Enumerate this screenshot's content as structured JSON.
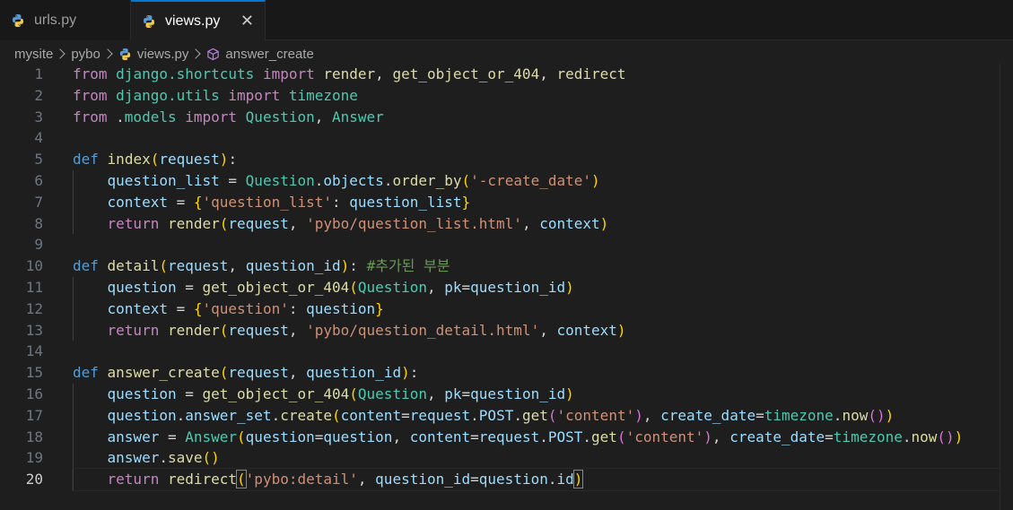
{
  "tabs": [
    {
      "label": "urls.py",
      "icon": "python-icon",
      "active": false
    },
    {
      "label": "views.py",
      "icon": "python-icon",
      "active": true
    }
  ],
  "close_glyph": "✕",
  "breadcrumb": {
    "items": [
      "mysite",
      "pybo",
      "views.py",
      "answer_create"
    ]
  },
  "colors": {
    "accent": "#0078d4",
    "background": "#1e1e1e",
    "keyword": "#c586c0",
    "def": "#569cd6",
    "function": "#dcdcaa",
    "class": "#4ec9b0",
    "variable": "#9cdcfe",
    "string": "#ce9178",
    "comment": "#6a9955"
  },
  "current_line": 20,
  "code_lines": [
    {
      "n": "1",
      "tokens": [
        [
          "kw",
          "from"
        ],
        [
          "txt",
          " "
        ],
        [
          "cls",
          "django.shortcuts"
        ],
        [
          "txt",
          " "
        ],
        [
          "kw",
          "import"
        ],
        [
          "txt",
          " "
        ],
        [
          "fn",
          "render"
        ],
        [
          "txt",
          ", "
        ],
        [
          "fn",
          "get_object_or_404"
        ],
        [
          "txt",
          ", "
        ],
        [
          "fn",
          "redirect"
        ]
      ]
    },
    {
      "n": "2",
      "tokens": [
        [
          "kw",
          "from"
        ],
        [
          "txt",
          " "
        ],
        [
          "cls",
          "django.utils"
        ],
        [
          "txt",
          " "
        ],
        [
          "kw",
          "import"
        ],
        [
          "txt",
          " "
        ],
        [
          "cls",
          "timezone"
        ]
      ]
    },
    {
      "n": "3",
      "tokens": [
        [
          "kw",
          "from"
        ],
        [
          "txt",
          " ."
        ],
        [
          "cls",
          "models"
        ],
        [
          "txt",
          " "
        ],
        [
          "kw",
          "import"
        ],
        [
          "txt",
          " "
        ],
        [
          "cls",
          "Question"
        ],
        [
          "txt",
          ", "
        ],
        [
          "cls",
          "Answer"
        ]
      ]
    },
    {
      "n": "4",
      "tokens": []
    },
    {
      "n": "5",
      "tokens": [
        [
          "def",
          "def"
        ],
        [
          "txt",
          " "
        ],
        [
          "fn",
          "index"
        ],
        [
          "b1",
          "("
        ],
        [
          "var",
          "request"
        ],
        [
          "b1",
          ")"
        ],
        [
          "txt",
          ":"
        ]
      ]
    },
    {
      "n": "6",
      "indent": true,
      "tokens": [
        [
          "txt",
          "    "
        ],
        [
          "var",
          "question_list"
        ],
        [
          "txt",
          " = "
        ],
        [
          "cls",
          "Question"
        ],
        [
          "txt",
          "."
        ],
        [
          "var",
          "objects"
        ],
        [
          "txt",
          "."
        ],
        [
          "fn",
          "order_by"
        ],
        [
          "b1",
          "("
        ],
        [
          "str",
          "'-create_date'"
        ],
        [
          "b1",
          ")"
        ]
      ]
    },
    {
      "n": "7",
      "indent": true,
      "tokens": [
        [
          "txt",
          "    "
        ],
        [
          "var",
          "context"
        ],
        [
          "txt",
          " = "
        ],
        [
          "b1",
          "{"
        ],
        [
          "str",
          "'question_list'"
        ],
        [
          "txt",
          ": "
        ],
        [
          "var",
          "question_list"
        ],
        [
          "b1",
          "}"
        ]
      ]
    },
    {
      "n": "8",
      "indent": true,
      "tokens": [
        [
          "txt",
          "    "
        ],
        [
          "kw",
          "return"
        ],
        [
          "txt",
          " "
        ],
        [
          "fn",
          "render"
        ],
        [
          "b1",
          "("
        ],
        [
          "var",
          "request"
        ],
        [
          "txt",
          ", "
        ],
        [
          "str",
          "'pybo/question_list.html'"
        ],
        [
          "txt",
          ", "
        ],
        [
          "var",
          "context"
        ],
        [
          "b1",
          ")"
        ]
      ]
    },
    {
      "n": "9",
      "tokens": []
    },
    {
      "n": "10",
      "tokens": [
        [
          "def",
          "def"
        ],
        [
          "txt",
          " "
        ],
        [
          "fn",
          "detail"
        ],
        [
          "b1",
          "("
        ],
        [
          "var",
          "request"
        ],
        [
          "txt",
          ", "
        ],
        [
          "var",
          "question_id"
        ],
        [
          "b1",
          ")"
        ],
        [
          "txt",
          ": "
        ],
        [
          "cmt",
          "#추가된 부분"
        ]
      ]
    },
    {
      "n": "11",
      "indent": true,
      "tokens": [
        [
          "txt",
          "    "
        ],
        [
          "var",
          "question"
        ],
        [
          "txt",
          " = "
        ],
        [
          "fn",
          "get_object_or_404"
        ],
        [
          "b1",
          "("
        ],
        [
          "cls",
          "Question"
        ],
        [
          "txt",
          ", "
        ],
        [
          "var",
          "pk"
        ],
        [
          "txt",
          "="
        ],
        [
          "var",
          "question_id"
        ],
        [
          "b1",
          ")"
        ]
      ]
    },
    {
      "n": "12",
      "indent": true,
      "tokens": [
        [
          "txt",
          "    "
        ],
        [
          "var",
          "context"
        ],
        [
          "txt",
          " = "
        ],
        [
          "b1",
          "{"
        ],
        [
          "str",
          "'question'"
        ],
        [
          "txt",
          ": "
        ],
        [
          "var",
          "question"
        ],
        [
          "b1",
          "}"
        ]
      ]
    },
    {
      "n": "13",
      "indent": true,
      "tokens": [
        [
          "txt",
          "    "
        ],
        [
          "kw",
          "return"
        ],
        [
          "txt",
          " "
        ],
        [
          "fn",
          "render"
        ],
        [
          "b1",
          "("
        ],
        [
          "var",
          "request"
        ],
        [
          "txt",
          ", "
        ],
        [
          "str",
          "'pybo/question_detail.html'"
        ],
        [
          "txt",
          ", "
        ],
        [
          "var",
          "context"
        ],
        [
          "b1",
          ")"
        ]
      ]
    },
    {
      "n": "14",
      "tokens": []
    },
    {
      "n": "15",
      "tokens": [
        [
          "def",
          "def"
        ],
        [
          "txt",
          " "
        ],
        [
          "fn",
          "answer_create"
        ],
        [
          "b1",
          "("
        ],
        [
          "var",
          "request"
        ],
        [
          "txt",
          ", "
        ],
        [
          "var",
          "question_id"
        ],
        [
          "b1",
          ")"
        ],
        [
          "txt",
          ":"
        ]
      ]
    },
    {
      "n": "16",
      "indent": true,
      "tokens": [
        [
          "txt",
          "    "
        ],
        [
          "var",
          "question"
        ],
        [
          "txt",
          " = "
        ],
        [
          "fn",
          "get_object_or_404"
        ],
        [
          "b1",
          "("
        ],
        [
          "cls",
          "Question"
        ],
        [
          "txt",
          ", "
        ],
        [
          "var",
          "pk"
        ],
        [
          "txt",
          "="
        ],
        [
          "var",
          "question_id"
        ],
        [
          "b1",
          ")"
        ]
      ]
    },
    {
      "n": "17",
      "indent": true,
      "tokens": [
        [
          "txt",
          "    "
        ],
        [
          "var",
          "question"
        ],
        [
          "txt",
          "."
        ],
        [
          "var",
          "answer_set"
        ],
        [
          "txt",
          "."
        ],
        [
          "fn",
          "create"
        ],
        [
          "b1",
          "("
        ],
        [
          "var",
          "content"
        ],
        [
          "txt",
          "="
        ],
        [
          "var",
          "request"
        ],
        [
          "txt",
          "."
        ],
        [
          "var",
          "POST"
        ],
        [
          "txt",
          "."
        ],
        [
          "fn",
          "get"
        ],
        [
          "b2",
          "("
        ],
        [
          "str",
          "'content'"
        ],
        [
          "b2",
          ")"
        ],
        [
          "txt",
          ", "
        ],
        [
          "var",
          "create_date"
        ],
        [
          "txt",
          "="
        ],
        [
          "cls",
          "timezone"
        ],
        [
          "txt",
          "."
        ],
        [
          "fn",
          "now"
        ],
        [
          "b2",
          "()"
        ],
        [
          "b1",
          ")"
        ]
      ]
    },
    {
      "n": "18",
      "indent": true,
      "tokens": [
        [
          "txt",
          "    "
        ],
        [
          "var",
          "answer"
        ],
        [
          "txt",
          " = "
        ],
        [
          "cls",
          "Answer"
        ],
        [
          "b1",
          "("
        ],
        [
          "var",
          "question"
        ],
        [
          "txt",
          "="
        ],
        [
          "var",
          "question"
        ],
        [
          "txt",
          ", "
        ],
        [
          "var",
          "content"
        ],
        [
          "txt",
          "="
        ],
        [
          "var",
          "request"
        ],
        [
          "txt",
          "."
        ],
        [
          "var",
          "POST"
        ],
        [
          "txt",
          "."
        ],
        [
          "fn",
          "get"
        ],
        [
          "b2",
          "("
        ],
        [
          "str",
          "'content'"
        ],
        [
          "b2",
          ")"
        ],
        [
          "txt",
          ", "
        ],
        [
          "var",
          "create_date"
        ],
        [
          "txt",
          "="
        ],
        [
          "cls",
          "timezone"
        ],
        [
          "txt",
          "."
        ],
        [
          "fn",
          "now"
        ],
        [
          "b2",
          "()"
        ],
        [
          "b1",
          ")"
        ]
      ]
    },
    {
      "n": "19",
      "indent": true,
      "tokens": [
        [
          "txt",
          "    "
        ],
        [
          "var",
          "answer"
        ],
        [
          "txt",
          "."
        ],
        [
          "fn",
          "save"
        ],
        [
          "b1",
          "()"
        ]
      ]
    },
    {
      "n": "20",
      "indent": true,
      "tokens": [
        [
          "txt",
          "    "
        ],
        [
          "kw",
          "return"
        ],
        [
          "txt",
          " "
        ],
        [
          "fn",
          "redirect"
        ],
        [
          "brm",
          "("
        ],
        [
          "str",
          "'pybo:detail'"
        ],
        [
          "txt",
          ", "
        ],
        [
          "var",
          "question_id"
        ],
        [
          "txt",
          "="
        ],
        [
          "var",
          "question"
        ],
        [
          "txt",
          "."
        ],
        [
          "var",
          "id"
        ],
        [
          "brm",
          ")"
        ]
      ]
    }
  ]
}
